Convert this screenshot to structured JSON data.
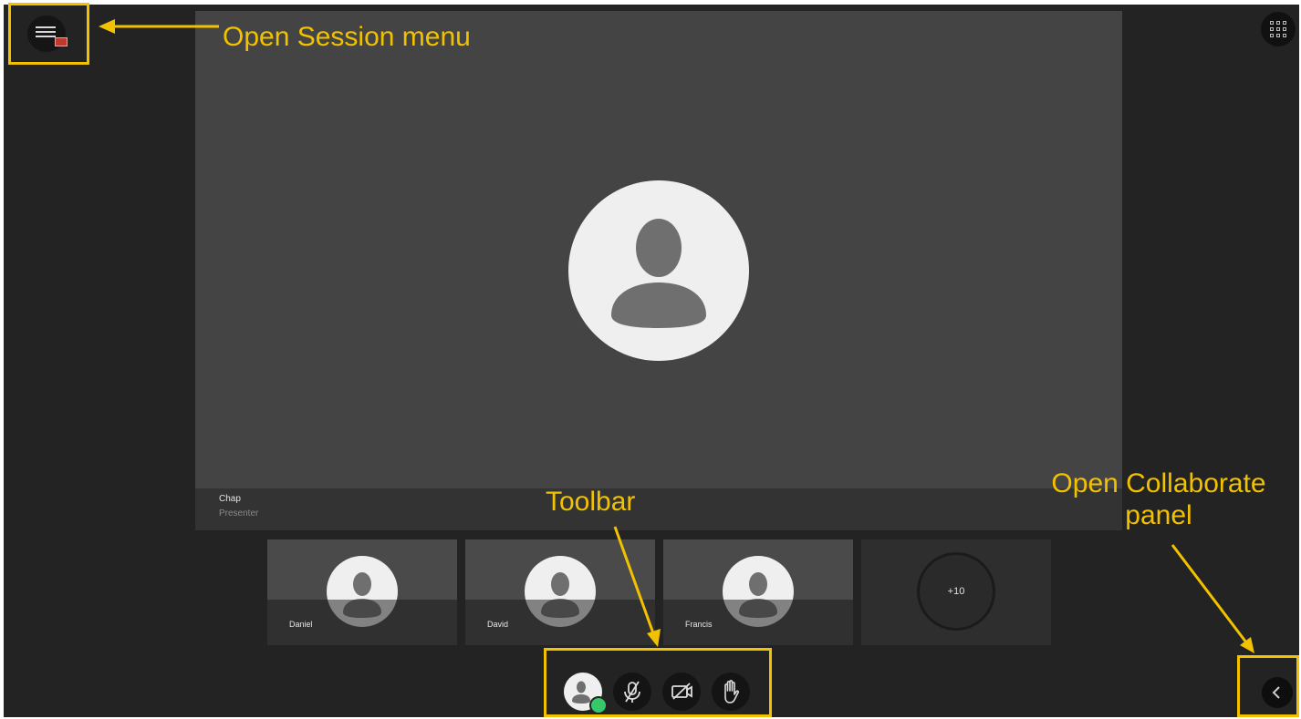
{
  "stage": {
    "presenter_name": "Chap",
    "presenter_role": "Presenter"
  },
  "participants": [
    {
      "name": "Daniel"
    },
    {
      "name": "David"
    },
    {
      "name": "Francis"
    }
  ],
  "more_participants": "+10",
  "toolbar": {
    "buttons": [
      "profile-status",
      "microphone-muted",
      "camera-off",
      "raise-hand"
    ],
    "status_color": "#37c86b"
  },
  "annotations": {
    "session_menu": "Open Session menu",
    "toolbar": "Toolbar",
    "collaborate_panel_line1": "Open Collaborate",
    "collaborate_panel_line2": "panel"
  },
  "colors": {
    "annotation": "#f2c200",
    "background": "#232323",
    "stage": "#444444"
  }
}
